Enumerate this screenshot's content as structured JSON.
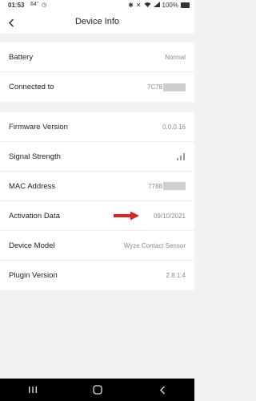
{
  "status_bar": {
    "time": "01:53",
    "temperature": "64°",
    "battery_percent": "100%"
  },
  "header": {
    "title": "Device Info",
    "back_icon": "chevron-left-icon"
  },
  "group1": [
    {
      "label": "Battery",
      "value": "Normal"
    },
    {
      "label": "Connected to",
      "value": "7C78"
    }
  ],
  "group2": [
    {
      "label": "Firmware Version",
      "value": "0.0.0.16"
    },
    {
      "label": "Signal Strength",
      "value_icon": "signal-strength-icon",
      "signal_level": 0.5
    },
    {
      "label": "MAC Address",
      "value": "7788"
    },
    {
      "label": "Activation Data",
      "value": "09/10/2021"
    },
    {
      "label": "Device Model",
      "value": "Wyze Contact Sensor"
    },
    {
      "label": "Plugin Version",
      "value": "2.8.1.4"
    }
  ],
  "annotation": {
    "arrow_color": "#e02020",
    "icon": "red-arrow-icon"
  },
  "nav_bar": {
    "recent_icon": "recent-apps-icon",
    "home_icon": "home-icon",
    "back_icon": "back-nav-icon"
  }
}
